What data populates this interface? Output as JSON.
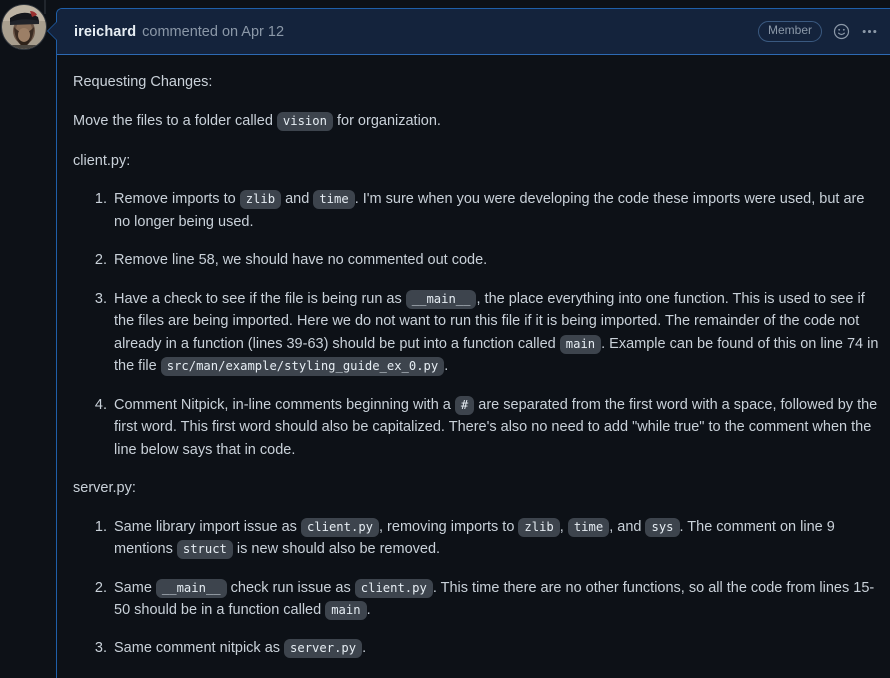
{
  "comment": {
    "author": "ireichard",
    "meta": "commented on Apr 12",
    "badge": "Member",
    "reaction_icon": "smiley-icon",
    "menu_icon": "kebab-menu-icon",
    "avatar_alt": "ireichard-avatar"
  },
  "body": {
    "intro": "Requesting Changes:",
    "move_files": {
      "before": "Move the files to a folder called",
      "code": "vision",
      "after": "for organization."
    },
    "client_heading": "client.py:",
    "server_heading": "server.py:",
    "client_items": [
      {
        "parts": [
          {
            "t": "text",
            "v": "Remove imports to "
          },
          {
            "t": "code",
            "v": "zlib"
          },
          {
            "t": "text",
            "v": " and "
          },
          {
            "t": "code",
            "v": "time"
          },
          {
            "t": "text",
            "v": ". I'm sure when you were developing the code these imports were used, but are no longer being used."
          }
        ]
      },
      {
        "parts": [
          {
            "t": "text",
            "v": "Remove line 58, we should have no commented out code."
          }
        ]
      },
      {
        "parts": [
          {
            "t": "text",
            "v": "Have a check to see if the file is being run as "
          },
          {
            "t": "code",
            "v": "__main__"
          },
          {
            "t": "text",
            "v": ", the place everything into one function. This is used to see if the files are being imported. Here we do not want to run this file if it is being imported. The remainder of the code not already in a function (lines 39-63) should be put into a function called "
          },
          {
            "t": "code",
            "v": "main"
          },
          {
            "t": "text",
            "v": ". Example can be found of this on line 74 in the file "
          },
          {
            "t": "code",
            "v": "src/man/example/styling_guide_ex_0.py"
          },
          {
            "t": "text",
            "v": "."
          }
        ]
      },
      {
        "parts": [
          {
            "t": "text",
            "v": "Comment Nitpick, in-line comments beginning with a "
          },
          {
            "t": "code",
            "v": "#"
          },
          {
            "t": "text",
            "v": " are separated from the first word with a space, followed by the first word. This first word should also be capitalized. There's also no need to add \"while true\" to the comment when the line below says that in code."
          }
        ]
      }
    ],
    "server_items": [
      {
        "parts": [
          {
            "t": "text",
            "v": "Same library import issue as "
          },
          {
            "t": "code",
            "v": "client.py"
          },
          {
            "t": "text",
            "v": ", removing imports to "
          },
          {
            "t": "code",
            "v": "zlib"
          },
          {
            "t": "text",
            "v": ", "
          },
          {
            "t": "code",
            "v": "time"
          },
          {
            "t": "text",
            "v": ", and "
          },
          {
            "t": "code",
            "v": "sys"
          },
          {
            "t": "text",
            "v": ". The comment on line 9 mentions "
          },
          {
            "t": "code",
            "v": "struct"
          },
          {
            "t": "text",
            "v": " is new should also be removed."
          }
        ]
      },
      {
        "parts": [
          {
            "t": "text",
            "v": "Same "
          },
          {
            "t": "code",
            "v": "__main__"
          },
          {
            "t": "text",
            "v": " check run issue as "
          },
          {
            "t": "code",
            "v": "client.py"
          },
          {
            "t": "text",
            "v": ". This time there are no other functions, so all the code from lines 15-50 should be in a function called "
          },
          {
            "t": "code",
            "v": "main"
          },
          {
            "t": "text",
            "v": "."
          }
        ]
      },
      {
        "parts": [
          {
            "t": "text",
            "v": "Same comment nitpick as "
          },
          {
            "t": "code",
            "v": "server.py"
          },
          {
            "t": "text",
            "v": "."
          }
        ]
      }
    ]
  },
  "colors": {
    "page_bg": "#0d1117",
    "header_bg": "#14233c",
    "accent_border": "#2d6ab4",
    "box_border": "#1f5fa9",
    "code_chip_bg": "#3d444d",
    "text": "#c9d1d9",
    "muted": "#8b98a8"
  }
}
